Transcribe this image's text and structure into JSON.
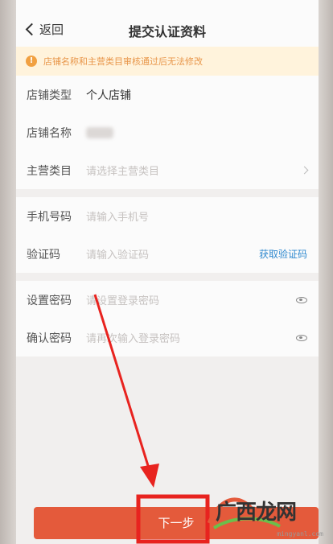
{
  "nav": {
    "back_label": "返回",
    "title": "提交认证资料"
  },
  "notice": {
    "icon": "!",
    "text": "店铺名称和主营类目审核通过后无法修改"
  },
  "store_group": [
    {
      "label": "店铺类型",
      "value": "个人店铺"
    },
    {
      "label": "店铺名称",
      "value": ""
    },
    {
      "label": "主营类目",
      "placeholder": "请选择主营类目"
    }
  ],
  "phone_group": [
    {
      "label": "手机号码",
      "placeholder": "请输入手机号"
    },
    {
      "label": "验证码",
      "placeholder": "请输入验证码",
      "action": "获取验证码"
    }
  ],
  "password_group": [
    {
      "label": "设置密码",
      "placeholder": "请设置登录密码"
    },
    {
      "label": "确认密码",
      "placeholder": "请再次输入登录密码"
    }
  ],
  "footer": {
    "next_label": "下一步"
  },
  "watermark": {
    "text": "广西龙网",
    "url": "mingyanl.com"
  },
  "colors": {
    "accent": "#e45a3b",
    "link": "#2f89cf",
    "annotation": "#e8231f"
  }
}
